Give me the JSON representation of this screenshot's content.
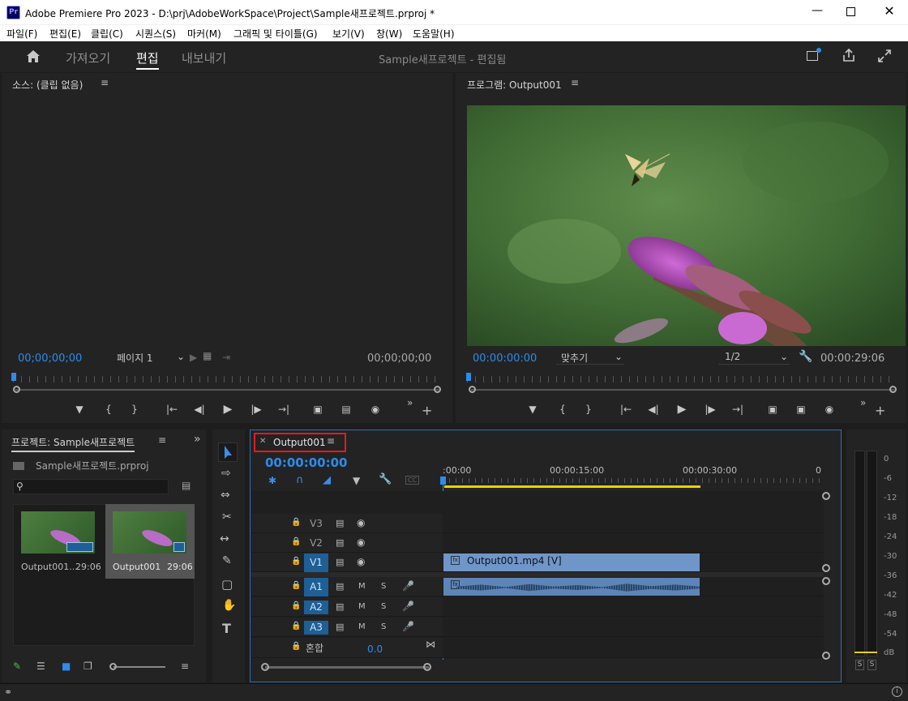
{
  "window": {
    "title": "Adobe Premiere Pro 2023 - D:\\prj\\AdobeWorkSpace\\Project\\Sample새프로젝트.prproj *",
    "app_badge": "Pr"
  },
  "menu": [
    "파일(F)",
    "편집(E)",
    "클립(C)",
    "시퀀스(S)",
    "마커(M)",
    "그래픽 및 타이틀(G)",
    "보기(V)",
    "창(W)",
    "도움말(H)"
  ],
  "nav": {
    "tabs": [
      "가져오기",
      "편집",
      "내보내기"
    ],
    "active_tab": "편집",
    "project_status": "Sample새프로젝트 - 편집됨"
  },
  "source": {
    "title": "소스: (클립 없음)",
    "timecode_in": "00;00;00;00",
    "timecode_out": "00;00;00;00",
    "page_select": "페이지 1"
  },
  "program": {
    "title": "프로그램: Output001",
    "timecode": "00:00:00:00",
    "fit": "맞추기",
    "resolution": "1/2",
    "duration": "00:00:29:06"
  },
  "project": {
    "title": "프로젝트: Sample새프로젝트",
    "file": "Sample새프로젝트.prproj",
    "items": [
      {
        "name": "Output001...",
        "duration": "29:06"
      },
      {
        "name": "Output001",
        "duration": "29:06"
      }
    ]
  },
  "timeline": {
    "tab": "Output001",
    "timecode": "00:00:00:00",
    "ruler": [
      ":00:00",
      "00:00:15:00",
      "00:00:30:00",
      "0"
    ],
    "video_tracks": [
      "V3",
      "V2",
      "V1"
    ],
    "audio_tracks": [
      "A1",
      "A2",
      "A3"
    ],
    "mix_label": "혼합",
    "mix_value": "0.0",
    "clip_label": "Output001.mp4 [V]"
  },
  "meter": {
    "ticks": [
      "0",
      "-6",
      "-12",
      "-18",
      "-24",
      "-30",
      "-36",
      "-42",
      "-48",
      "-54",
      "dB"
    ],
    "solo": [
      "S",
      "S"
    ]
  },
  "colors": {
    "accent": "#2d8ceb",
    "clip_video": "#6f96c9",
    "clip_audio": "#5d85b8",
    "track_on": "#1e5f96",
    "highlight": "#e21c1c",
    "work_area": "#e6d400"
  }
}
